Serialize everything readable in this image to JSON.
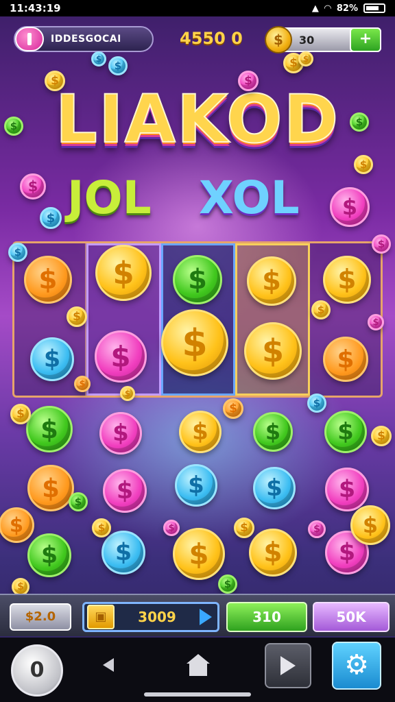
{
  "status_bar": {
    "time": "11:43:19",
    "battery": "82%"
  },
  "hud_top": {
    "player_name": "IDDESGOCAI",
    "score": "4550 0",
    "coin_count": "30",
    "plus_label": "+",
    "coin_symbol": "$"
  },
  "title": {
    "main": "LIAKOD",
    "sub_left": "JOL",
    "sub_right": "XOL"
  },
  "coin_symbol": "$",
  "bottom_hud": {
    "bet": "$2.0",
    "win_value": "3009",
    "spin_label": "310",
    "auto_label": "50K"
  },
  "navbar": {
    "round_label": "0",
    "gear_label": "⚙"
  },
  "colors": {
    "gold": "#ffc21a",
    "orange": "#ff9a1f",
    "green": "#41c81e",
    "pink": "#f13fbf",
    "blue": "#3cbdf2",
    "bg_purple": "#7a2ba3"
  }
}
